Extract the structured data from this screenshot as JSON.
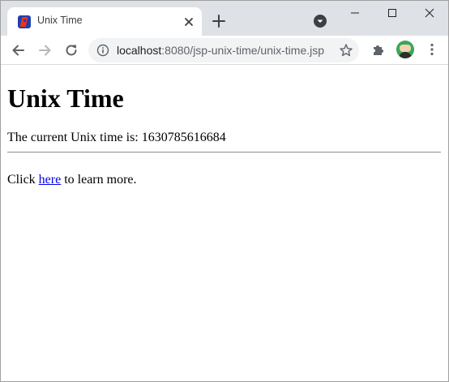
{
  "browser": {
    "tab": {
      "title": "Unix Time"
    },
    "omnibox": {
      "url_host": "localhost",
      "url_rest": ":8080/jsp-unix-time/unix-time.jsp"
    }
  },
  "page": {
    "heading": "Unix Time",
    "time_prefix": "The current Unix time is: ",
    "unix_time": "1630785616684",
    "more_prefix": "Click ",
    "more_link": "here",
    "more_suffix": " to learn more."
  },
  "icons": {
    "favicon": "jsp-favicon",
    "tab_close": "close-icon",
    "new_tab": "plus-icon",
    "tab_search": "chevron-down-icon",
    "minimize": "minimize-icon",
    "maximize": "maximize-icon",
    "close_window": "close-icon",
    "back": "arrow-left-icon",
    "forward": "arrow-right-icon",
    "reload": "reload-icon",
    "site_info": "info-icon",
    "bookmark": "star-icon",
    "extensions": "puzzle-icon",
    "profile": "avatar",
    "menu": "more-vertical-icon"
  },
  "colors": {
    "tabstrip": "#dee1e6",
    "omnibox": "#f1f3f4",
    "link": "#0000ee"
  }
}
